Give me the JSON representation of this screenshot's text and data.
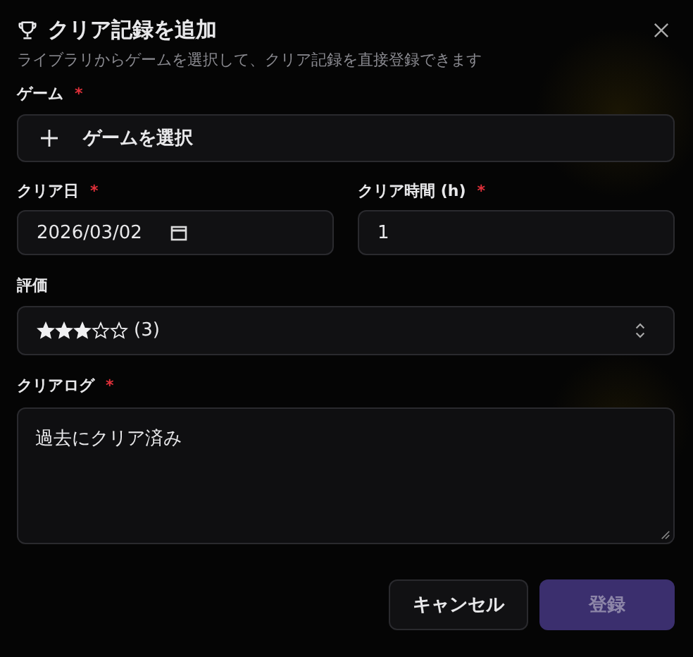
{
  "dialog": {
    "title": "クリア記録を追加",
    "subtitle": "ライブラリからゲームを選択して、クリア記録を直接登録できます"
  },
  "game": {
    "label": "ゲーム",
    "required_mark": "*",
    "button": "ゲームを選択"
  },
  "clear_date": {
    "label": "クリア日",
    "required_mark": "*",
    "value": "2026/03/02"
  },
  "clear_time": {
    "label": "クリア時間 (h)",
    "required_mark": "*",
    "value": "1"
  },
  "rating": {
    "label": "評価",
    "stars": 3,
    "value": "(3)"
  },
  "clear_log": {
    "label": "クリアログ",
    "required_mark": "*",
    "value": "過去にクリア済み"
  },
  "buttons": [
    {
      "label": "キャンセル",
      "kind": "secondary",
      "disabled": false
    },
    {
      "label": "登録",
      "kind": "primary",
      "disabled": true
    }
  ]
}
